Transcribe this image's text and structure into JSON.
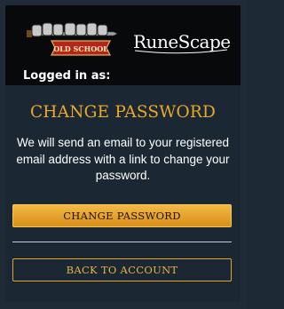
{
  "header": {
    "osrs_logo_text": "OLD SCHOOL",
    "rs_logo_text": "RuneScape",
    "logged_in_label": "Logged in as:"
  },
  "panel": {
    "title": "CHANGE PASSWORD",
    "description": "We will send an email to your registered email address with a link to change your password.",
    "primary_button_label": "CHANGE PASSWORD",
    "secondary_button_label": "BACK TO ACCOUNT"
  },
  "colors": {
    "accent_gold": "#e8a92a",
    "panel_bg": "#1b2833",
    "header_bg": "#07090b"
  }
}
